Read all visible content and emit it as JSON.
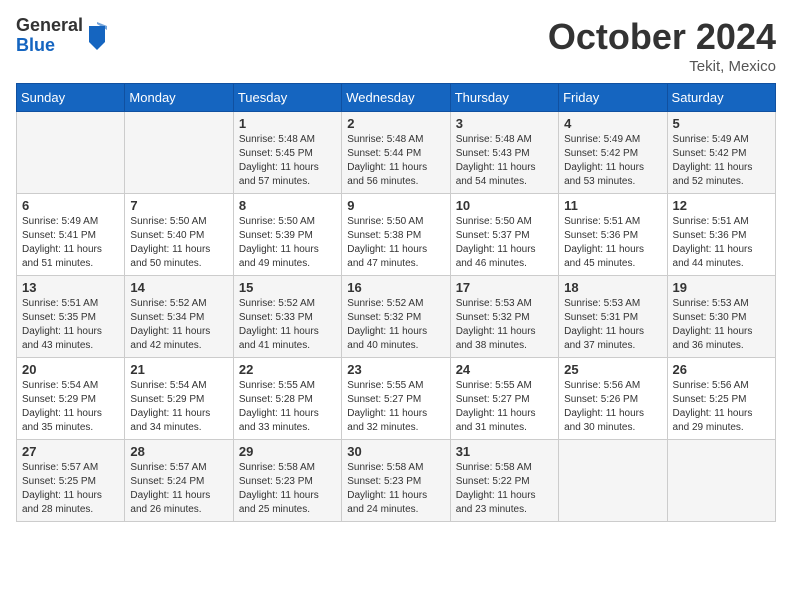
{
  "logo": {
    "general": "General",
    "blue": "Blue"
  },
  "title": "October 2024",
  "subtitle": "Tekit, Mexico",
  "days_header": [
    "Sunday",
    "Monday",
    "Tuesday",
    "Wednesday",
    "Thursday",
    "Friday",
    "Saturday"
  ],
  "weeks": [
    [
      {
        "day": "",
        "info": ""
      },
      {
        "day": "",
        "info": ""
      },
      {
        "day": "1",
        "info": "Sunrise: 5:48 AM\nSunset: 5:45 PM\nDaylight: 11 hours and 57 minutes."
      },
      {
        "day": "2",
        "info": "Sunrise: 5:48 AM\nSunset: 5:44 PM\nDaylight: 11 hours and 56 minutes."
      },
      {
        "day": "3",
        "info": "Sunrise: 5:48 AM\nSunset: 5:43 PM\nDaylight: 11 hours and 54 minutes."
      },
      {
        "day": "4",
        "info": "Sunrise: 5:49 AM\nSunset: 5:42 PM\nDaylight: 11 hours and 53 minutes."
      },
      {
        "day": "5",
        "info": "Sunrise: 5:49 AM\nSunset: 5:42 PM\nDaylight: 11 hours and 52 minutes."
      }
    ],
    [
      {
        "day": "6",
        "info": "Sunrise: 5:49 AM\nSunset: 5:41 PM\nDaylight: 11 hours and 51 minutes."
      },
      {
        "day": "7",
        "info": "Sunrise: 5:50 AM\nSunset: 5:40 PM\nDaylight: 11 hours and 50 minutes."
      },
      {
        "day": "8",
        "info": "Sunrise: 5:50 AM\nSunset: 5:39 PM\nDaylight: 11 hours and 49 minutes."
      },
      {
        "day": "9",
        "info": "Sunrise: 5:50 AM\nSunset: 5:38 PM\nDaylight: 11 hours and 47 minutes."
      },
      {
        "day": "10",
        "info": "Sunrise: 5:50 AM\nSunset: 5:37 PM\nDaylight: 11 hours and 46 minutes."
      },
      {
        "day": "11",
        "info": "Sunrise: 5:51 AM\nSunset: 5:36 PM\nDaylight: 11 hours and 45 minutes."
      },
      {
        "day": "12",
        "info": "Sunrise: 5:51 AM\nSunset: 5:36 PM\nDaylight: 11 hours and 44 minutes."
      }
    ],
    [
      {
        "day": "13",
        "info": "Sunrise: 5:51 AM\nSunset: 5:35 PM\nDaylight: 11 hours and 43 minutes."
      },
      {
        "day": "14",
        "info": "Sunrise: 5:52 AM\nSunset: 5:34 PM\nDaylight: 11 hours and 42 minutes."
      },
      {
        "day": "15",
        "info": "Sunrise: 5:52 AM\nSunset: 5:33 PM\nDaylight: 11 hours and 41 minutes."
      },
      {
        "day": "16",
        "info": "Sunrise: 5:52 AM\nSunset: 5:32 PM\nDaylight: 11 hours and 40 minutes."
      },
      {
        "day": "17",
        "info": "Sunrise: 5:53 AM\nSunset: 5:32 PM\nDaylight: 11 hours and 38 minutes."
      },
      {
        "day": "18",
        "info": "Sunrise: 5:53 AM\nSunset: 5:31 PM\nDaylight: 11 hours and 37 minutes."
      },
      {
        "day": "19",
        "info": "Sunrise: 5:53 AM\nSunset: 5:30 PM\nDaylight: 11 hours and 36 minutes."
      }
    ],
    [
      {
        "day": "20",
        "info": "Sunrise: 5:54 AM\nSunset: 5:29 PM\nDaylight: 11 hours and 35 minutes."
      },
      {
        "day": "21",
        "info": "Sunrise: 5:54 AM\nSunset: 5:29 PM\nDaylight: 11 hours and 34 minutes."
      },
      {
        "day": "22",
        "info": "Sunrise: 5:55 AM\nSunset: 5:28 PM\nDaylight: 11 hours and 33 minutes."
      },
      {
        "day": "23",
        "info": "Sunrise: 5:55 AM\nSunset: 5:27 PM\nDaylight: 11 hours and 32 minutes."
      },
      {
        "day": "24",
        "info": "Sunrise: 5:55 AM\nSunset: 5:27 PM\nDaylight: 11 hours and 31 minutes."
      },
      {
        "day": "25",
        "info": "Sunrise: 5:56 AM\nSunset: 5:26 PM\nDaylight: 11 hours and 30 minutes."
      },
      {
        "day": "26",
        "info": "Sunrise: 5:56 AM\nSunset: 5:25 PM\nDaylight: 11 hours and 29 minutes."
      }
    ],
    [
      {
        "day": "27",
        "info": "Sunrise: 5:57 AM\nSunset: 5:25 PM\nDaylight: 11 hours and 28 minutes."
      },
      {
        "day": "28",
        "info": "Sunrise: 5:57 AM\nSunset: 5:24 PM\nDaylight: 11 hours and 26 minutes."
      },
      {
        "day": "29",
        "info": "Sunrise: 5:58 AM\nSunset: 5:23 PM\nDaylight: 11 hours and 25 minutes."
      },
      {
        "day": "30",
        "info": "Sunrise: 5:58 AM\nSunset: 5:23 PM\nDaylight: 11 hours and 24 minutes."
      },
      {
        "day": "31",
        "info": "Sunrise: 5:58 AM\nSunset: 5:22 PM\nDaylight: 11 hours and 23 minutes."
      },
      {
        "day": "",
        "info": ""
      },
      {
        "day": "",
        "info": ""
      }
    ]
  ]
}
